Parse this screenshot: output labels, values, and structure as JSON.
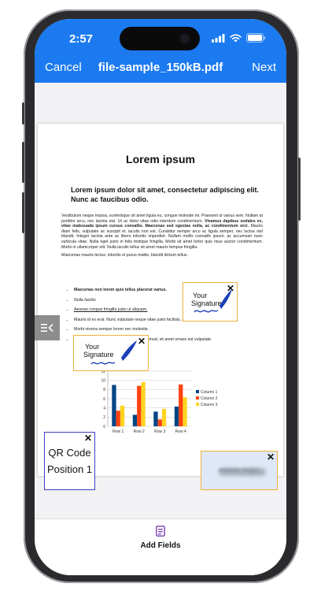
{
  "status": {
    "time": "2:57"
  },
  "nav": {
    "cancel_label": "Cancel",
    "title": "file-sample_150kB.pdf",
    "next_label": "Next"
  },
  "document": {
    "title": "Lorem ipsum",
    "subtitle": "Lorem ipsum dolor sit amet, consectetur adipiscing elit. Nunc ac faucibus odio.",
    "paragraph1_a": "Vestibulum neque massa, scelerisque sit amet ligula eu, congue molestie mi. Praesent ut varius sem. Nullam at porttitor arcu, nec lacinia nisi. Ut ac dolor vitae odio interdum condimentum. ",
    "paragraph1_bold": "Vivamus dapibus sodales ex, vitae malesuada ipsum cursus convallis. Maecenas sed egestas nulla, ac condimentum orci.",
    "paragraph1_b": " Mauris diam felis, vulputate ac suscipit et, iaculis non est. Curabitur semper arcu ac ligula semper, nec luctus nisl blandit. Integer lacinia ante ac libero lobortis imperdiet. ",
    "paragraph1_italic": "Nullam mollis convallis ipsum, ac accumsan nunc vehicula vitae.",
    "paragraph1_c": " Nulla eget justo in felis tristique fringilla. Morbi sit amet tortor quis risus auctor condimentum. Morbi in ullamcorper elit. Nulla iaculis tellus sit amet mauris tempus fringilla.",
    "paragraph2": "Maecenas mauris lectus, lobortis et purus mattis, blandit dictum tellus.",
    "list": [
      "Maecenas non lorem quis tellus placerat varius.",
      "Nulla facilisi.",
      "Aenean congue fringilla justo ut aliquam.",
      "Mauris id ex erat. Nunc vulputate neque vitae justo facilisis, non condimentum ante sagittis.",
      "Morbi viverra semper lorem nec molestie.",
      "Maecenas tincidunt est efficitur ligula euismod, sit amet ornare est vulputate."
    ]
  },
  "chart_data": {
    "type": "bar",
    "categories": [
      "Row 1",
      "Row 2",
      "Row 3",
      "Row 4"
    ],
    "series": [
      {
        "name": "Column 1",
        "values": [
          9,
          2.5,
          3.2,
          4.3
        ],
        "color": "#004586"
      },
      {
        "name": "Column 2",
        "values": [
          3.4,
          8.8,
          1.5,
          9.1
        ],
        "color": "#ff420e"
      },
      {
        "name": "Column 3",
        "values": [
          4.5,
          9.6,
          3.8,
          6.3
        ],
        "color": "#ffd320"
      }
    ],
    "ylim": [
      0,
      12
    ],
    "yticks": [
      "0",
      "2",
      "4",
      "6",
      "8",
      "10",
      "12"
    ],
    "grid": true,
    "legend": "right"
  },
  "fields": {
    "signature_label_1": "Your",
    "signature_label_2": "Signature",
    "qr_line_1": "QR Code",
    "qr_line_2": "Position 1",
    "name_value": "••••••• ••an"
  },
  "toolbar": {
    "add_fields_label": "Add Fields"
  },
  "colors": {
    "header": "#1b7af0",
    "signature_border": "#f0b13a",
    "qr_border": "#3d3dbf",
    "name_field_bg": "#dfe8f6"
  }
}
